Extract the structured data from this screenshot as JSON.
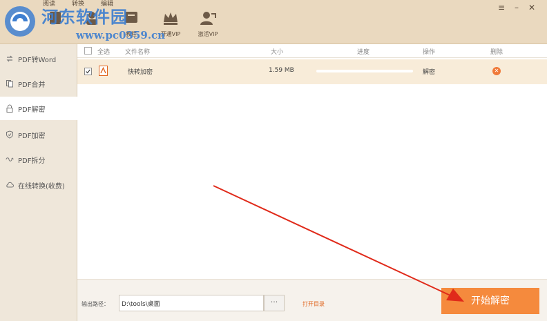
{
  "brand": {
    "watermark_title": "河东软件园",
    "watermark_url": "www.pc0359.cn"
  },
  "top_tabs": [
    "阅读",
    "转换",
    "编辑"
  ],
  "toolbar": [
    {
      "label": "",
      "icon": "doc-icon"
    },
    {
      "label": "",
      "icon": "convert-icon"
    },
    {
      "label": "教程",
      "icon": "tutorial-icon"
    },
    {
      "label": "开通VIP",
      "icon": "crown-icon"
    },
    {
      "label": "激活VIP",
      "icon": "user-activate-icon"
    }
  ],
  "window_controls": {
    "menu": "≡",
    "minimize": "–",
    "close": "✕"
  },
  "sidebar": {
    "items": [
      {
        "label": "PDF转Word",
        "icon": "convert-icon"
      },
      {
        "label": "PDF合并",
        "icon": "merge-icon"
      },
      {
        "label": "PDF解密",
        "icon": "lock-icon"
      },
      {
        "label": "PDF加密",
        "icon": "shield-icon"
      },
      {
        "label": "PDF拆分",
        "icon": "split-icon"
      },
      {
        "label": "在线转换(收费)",
        "icon": "cloud-icon"
      }
    ],
    "active_index": 2
  },
  "table": {
    "headers": {
      "select_all": "全选",
      "filename": "文件名称",
      "size": "大小",
      "progress": "进度",
      "action": "操作",
      "delete": "删除"
    },
    "rows": [
      {
        "filename": "快转加密",
        "size": "1.59 MB",
        "progress": 0,
        "action": "解密",
        "checked": true
      }
    ]
  },
  "output": {
    "label": "输出路径：",
    "path": "D:\\tools\\桌面",
    "browse_label": "···",
    "open_dir": "打开目录"
  },
  "start_button": "开始解密",
  "colors": {
    "accent": "#f58a3d",
    "watermark": "#3f7fd0",
    "row_bg": "#f8ecd9",
    "arrow": "#e02a1a"
  }
}
